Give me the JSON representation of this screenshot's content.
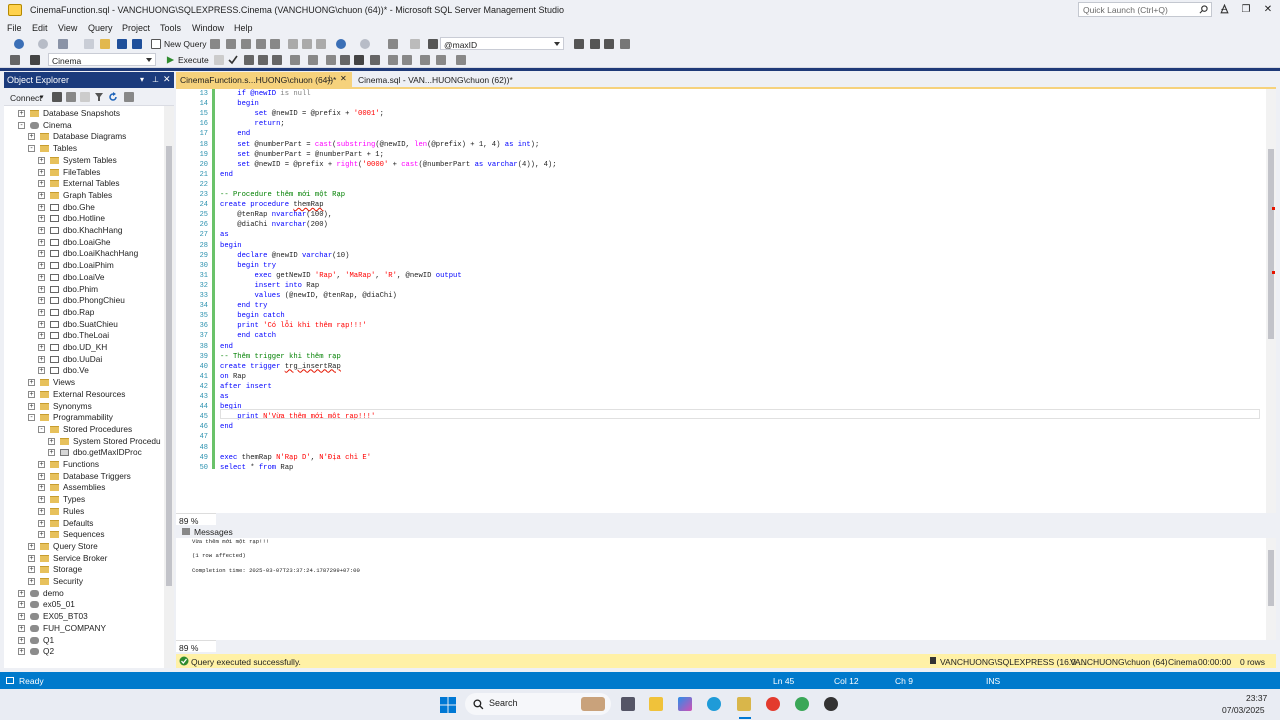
{
  "window": {
    "title": "CinemaFunction.sql - VANCHUONG\\SQLEXPRESS.Cinema (VANCHUONG\\chuon (64))* - Microsoft SQL Server Management Studio",
    "quick_launch": "Quick Launch (Ctrl+Q)"
  },
  "menu": [
    "File",
    "Edit",
    "View",
    "Query",
    "Project",
    "Tools",
    "Window",
    "Help"
  ],
  "toolbar": {
    "new_query": "New Query",
    "param_combo": "@maxID",
    "db_combo": "Cinema",
    "execute": "Execute"
  },
  "object_explorer": {
    "title": "Object Explorer",
    "connect": "Connect",
    "tree": [
      {
        "label": "Database Snapshots",
        "indent": 2,
        "icon": "folder",
        "exp": "+"
      },
      {
        "label": "Cinema",
        "indent": 2,
        "icon": "db",
        "exp": "-"
      },
      {
        "label": "Database Diagrams",
        "indent": 3,
        "icon": "folder",
        "exp": "+"
      },
      {
        "label": "Tables",
        "indent": 3,
        "icon": "folder",
        "exp": "-"
      },
      {
        "label": "System Tables",
        "indent": 4,
        "icon": "folder",
        "exp": "+"
      },
      {
        "label": "FileTables",
        "indent": 4,
        "icon": "folder",
        "exp": "+"
      },
      {
        "label": "External Tables",
        "indent": 4,
        "icon": "folder",
        "exp": "+"
      },
      {
        "label": "Graph Tables",
        "indent": 4,
        "icon": "folder",
        "exp": "+"
      },
      {
        "label": "dbo.Ghe",
        "indent": 4,
        "icon": "table",
        "exp": "+"
      },
      {
        "label": "dbo.Hotline",
        "indent": 4,
        "icon": "table",
        "exp": "+"
      },
      {
        "label": "dbo.KhachHang",
        "indent": 4,
        "icon": "table",
        "exp": "+"
      },
      {
        "label": "dbo.LoaiGhe",
        "indent": 4,
        "icon": "table",
        "exp": "+"
      },
      {
        "label": "dbo.LoaiKhachHang",
        "indent": 4,
        "icon": "table",
        "exp": "+"
      },
      {
        "label": "dbo.LoaiPhim",
        "indent": 4,
        "icon": "table",
        "exp": "+"
      },
      {
        "label": "dbo.LoaiVe",
        "indent": 4,
        "icon": "table",
        "exp": "+"
      },
      {
        "label": "dbo.Phim",
        "indent": 4,
        "icon": "table",
        "exp": "+"
      },
      {
        "label": "dbo.PhongChieu",
        "indent": 4,
        "icon": "table",
        "exp": "+"
      },
      {
        "label": "dbo.Rap",
        "indent": 4,
        "icon": "table",
        "exp": "+"
      },
      {
        "label": "dbo.SuatChieu",
        "indent": 4,
        "icon": "table",
        "exp": "+"
      },
      {
        "label": "dbo.TheLoai",
        "indent": 4,
        "icon": "table",
        "exp": "+"
      },
      {
        "label": "dbo.UD_KH",
        "indent": 4,
        "icon": "table",
        "exp": "+"
      },
      {
        "label": "dbo.UuDai",
        "indent": 4,
        "icon": "table",
        "exp": "+"
      },
      {
        "label": "dbo.Ve",
        "indent": 4,
        "icon": "table",
        "exp": "+"
      },
      {
        "label": "Views",
        "indent": 3,
        "icon": "folder",
        "exp": "+"
      },
      {
        "label": "External Resources",
        "indent": 3,
        "icon": "folder",
        "exp": "+"
      },
      {
        "label": "Synonyms",
        "indent": 3,
        "icon": "folder",
        "exp": "+"
      },
      {
        "label": "Programmability",
        "indent": 3,
        "icon": "folder",
        "exp": "-"
      },
      {
        "label": "Stored Procedures",
        "indent": 4,
        "icon": "folder",
        "exp": "-"
      },
      {
        "label": "System Stored Procedu",
        "indent": 5,
        "icon": "folder",
        "exp": "+"
      },
      {
        "label": "dbo.getMaxIDProc",
        "indent": 5,
        "icon": "proc",
        "exp": "+"
      },
      {
        "label": "Functions",
        "indent": 4,
        "icon": "folder",
        "exp": "+"
      },
      {
        "label": "Database Triggers",
        "indent": 4,
        "icon": "folder",
        "exp": "+"
      },
      {
        "label": "Assemblies",
        "indent": 4,
        "icon": "folder",
        "exp": "+"
      },
      {
        "label": "Types",
        "indent": 4,
        "icon": "folder",
        "exp": "+"
      },
      {
        "label": "Rules",
        "indent": 4,
        "icon": "folder",
        "exp": "+"
      },
      {
        "label": "Defaults",
        "indent": 4,
        "icon": "folder",
        "exp": "+"
      },
      {
        "label": "Sequences",
        "indent": 4,
        "icon": "folder",
        "exp": "+"
      },
      {
        "label": "Query Store",
        "indent": 3,
        "icon": "folder",
        "exp": "+"
      },
      {
        "label": "Service Broker",
        "indent": 3,
        "icon": "folder",
        "exp": "+"
      },
      {
        "label": "Storage",
        "indent": 3,
        "icon": "folder",
        "exp": "+"
      },
      {
        "label": "Security",
        "indent": 3,
        "icon": "folder",
        "exp": "+"
      },
      {
        "label": "demo",
        "indent": 2,
        "icon": "db",
        "exp": "+"
      },
      {
        "label": "ex05_01",
        "indent": 2,
        "icon": "db",
        "exp": "+"
      },
      {
        "label": "EX05_BT03",
        "indent": 2,
        "icon": "db",
        "exp": "+"
      },
      {
        "label": "FUH_COMPANY",
        "indent": 2,
        "icon": "db",
        "exp": "+"
      },
      {
        "label": "Q1",
        "indent": 2,
        "icon": "db",
        "exp": "+"
      },
      {
        "label": "Q2",
        "indent": 2,
        "icon": "db",
        "exp": "+"
      }
    ]
  },
  "tabs": [
    {
      "label": "CinemaFunction.s...HUONG\\chuon (64))*",
      "active": true
    },
    {
      "label": "Cinema.sql - VAN...HUONG\\chuon (62))*",
      "active": false
    }
  ],
  "editor": {
    "zoom": "89 %",
    "lines": [
      {
        "n": 13,
        "t": [
          [
            "    if @newID ",
            "kw"
          ],
          [
            "is null",
            "gr"
          ]
        ]
      },
      {
        "n": 14,
        "t": [
          [
            "    begin",
            "kw"
          ]
        ]
      },
      {
        "n": 15,
        "t": [
          [
            "        set ",
            "kw"
          ],
          [
            "@newID = @prefix + ",
            ""
          ],
          [
            "'0001'",
            "str"
          ],
          [
            ";",
            ""
          ]
        ]
      },
      {
        "n": 16,
        "t": [
          [
            "        return",
            "kw"
          ],
          [
            ";",
            ""
          ]
        ]
      },
      {
        "n": 17,
        "t": [
          [
            "    end",
            "kw"
          ]
        ]
      },
      {
        "n": 18,
        "t": [
          [
            "    set ",
            "kw"
          ],
          [
            "@numberPart = ",
            ""
          ],
          [
            "cast",
            "fn"
          ],
          [
            "(",
            ""
          ],
          [
            "substring",
            "fn"
          ],
          [
            "(@newID, ",
            ""
          ],
          [
            "len",
            "fn"
          ],
          [
            "(@prefix) + 1, 4) ",
            ""
          ],
          [
            "as int",
            "kw"
          ],
          [
            ");",
            ""
          ]
        ]
      },
      {
        "n": 19,
        "t": [
          [
            "    set ",
            "kw"
          ],
          [
            "@numberPart = @numberPart + 1;",
            ""
          ]
        ]
      },
      {
        "n": 20,
        "t": [
          [
            "    set ",
            "kw"
          ],
          [
            "@newID = @prefix + ",
            ""
          ],
          [
            "right",
            "fn"
          ],
          [
            "(",
            ""
          ],
          [
            "'0000'",
            "str"
          ],
          [
            " + ",
            ""
          ],
          [
            "cast",
            "fn"
          ],
          [
            "(@numberPart ",
            ""
          ],
          [
            "as varchar",
            "kw"
          ],
          [
            "(4)), 4);",
            ""
          ]
        ]
      },
      {
        "n": 21,
        "t": [
          [
            "end",
            "kw"
          ]
        ]
      },
      {
        "n": 22,
        "t": [
          [
            "",
            ""
          ]
        ]
      },
      {
        "n": 23,
        "t": [
          [
            "-- Procedure thêm mới một Rạp",
            "cm"
          ]
        ]
      },
      {
        "n": 24,
        "t": [
          [
            "create procedure ",
            "kw"
          ],
          [
            "themRap",
            "sq"
          ]
        ]
      },
      {
        "n": 25,
        "t": [
          [
            "    @tenRap ",
            ""
          ],
          [
            "nvarchar",
            "kw"
          ],
          [
            "(100),",
            ""
          ]
        ]
      },
      {
        "n": 26,
        "t": [
          [
            "    @diaChi ",
            ""
          ],
          [
            "nvarchar",
            "kw"
          ],
          [
            "(200)",
            ""
          ]
        ]
      },
      {
        "n": 27,
        "t": [
          [
            "as",
            "kw"
          ]
        ]
      },
      {
        "n": 28,
        "t": [
          [
            "begin",
            "kw"
          ]
        ]
      },
      {
        "n": 29,
        "t": [
          [
            "    declare ",
            "kw"
          ],
          [
            "@newID ",
            ""
          ],
          [
            "varchar",
            "kw"
          ],
          [
            "(10)",
            ""
          ]
        ]
      },
      {
        "n": 30,
        "t": [
          [
            "    begin try",
            "kw"
          ]
        ]
      },
      {
        "n": 31,
        "t": [
          [
            "        exec ",
            "kw"
          ],
          [
            "getNewID ",
            ""
          ],
          [
            "'Rap'",
            "str"
          ],
          [
            ", ",
            ""
          ],
          [
            "'MaRap'",
            "str"
          ],
          [
            ", ",
            ""
          ],
          [
            "'R'",
            "str"
          ],
          [
            ", @newID ",
            ""
          ],
          [
            "output",
            "kw"
          ]
        ]
      },
      {
        "n": 32,
        "t": [
          [
            "        insert into ",
            "kw"
          ],
          [
            "Rap",
            ""
          ]
        ]
      },
      {
        "n": 33,
        "t": [
          [
            "        values ",
            "kw"
          ],
          [
            "(@newID, @tenRap, @diaChi)",
            ""
          ]
        ]
      },
      {
        "n": 34,
        "t": [
          [
            "    end try",
            "kw"
          ]
        ]
      },
      {
        "n": 35,
        "t": [
          [
            "    begin catch",
            "kw"
          ]
        ]
      },
      {
        "n": 36,
        "t": [
          [
            "    print ",
            "kw"
          ],
          [
            "'Có lỗi khi thêm rạp!!!'",
            "str"
          ]
        ]
      },
      {
        "n": 37,
        "t": [
          [
            "    end catch",
            "kw"
          ]
        ]
      },
      {
        "n": 38,
        "t": [
          [
            "end",
            "kw"
          ]
        ]
      },
      {
        "n": 39,
        "t": [
          [
            "-- Thêm trigger khi thêm rạp",
            "cm"
          ]
        ]
      },
      {
        "n": 40,
        "t": [
          [
            "create trigger ",
            "kw"
          ],
          [
            "trg_insertRap",
            "sq"
          ]
        ]
      },
      {
        "n": 41,
        "t": [
          [
            "on ",
            "kw"
          ],
          [
            "Rap",
            ""
          ]
        ]
      },
      {
        "n": 42,
        "t": [
          [
            "after insert",
            "kw"
          ]
        ]
      },
      {
        "n": 43,
        "t": [
          [
            "as",
            "kw"
          ]
        ]
      },
      {
        "n": 44,
        "t": [
          [
            "begin",
            "kw"
          ]
        ]
      },
      {
        "n": 45,
        "t": [
          [
            "    print ",
            "kw"
          ],
          [
            "N'Vừa thêm mới một rạp!!!'",
            "str"
          ]
        ]
      },
      {
        "n": 46,
        "t": [
          [
            "end",
            "kw"
          ]
        ]
      },
      {
        "n": 47,
        "t": [
          [
            "",
            ""
          ]
        ]
      },
      {
        "n": 48,
        "t": [
          [
            "",
            ""
          ]
        ]
      },
      {
        "n": 49,
        "t": [
          [
            "exec ",
            "kw"
          ],
          [
            "themRap ",
            ""
          ],
          [
            "N'Rạp D'",
            "str"
          ],
          [
            ", ",
            ""
          ],
          [
            "N'Địa chỉ E'",
            "str"
          ]
        ]
      },
      {
        "n": 50,
        "t": [
          [
            "select ",
            "kw"
          ],
          [
            "* ",
            ""
          ],
          [
            "from ",
            "kw"
          ],
          [
            "Rap",
            ""
          ]
        ]
      }
    ]
  },
  "messages": {
    "tab": "Messages",
    "zoom": "89 %",
    "lines": [
      "Vừa thêm mới một rạp!!!",
      "(1 row affected)",
      "Completion time: 2025-03-07T23:37:24.1787299+07:00"
    ]
  },
  "query_status": {
    "text": "Query executed successfully.",
    "server": "VANCHUONG\\SQLEXPRESS (16.0 ...",
    "user": "VANCHUONG\\chuon (64)",
    "db": "Cinema",
    "time": "00:00:00",
    "rows": "0 rows"
  },
  "statusbar": {
    "ready": "Ready",
    "ln": "Ln 45",
    "col": "Col 12",
    "ch": "Ch 9",
    "ins": "INS"
  },
  "taskbar": {
    "search": "Search",
    "time": "23:37",
    "date": "07/03/2025"
  },
  "colors": {
    "accent": "#007acc",
    "tab_active": "#f6d27c",
    "status_yellow": "#fff1a6",
    "oe_header": "#1b3b7c"
  }
}
